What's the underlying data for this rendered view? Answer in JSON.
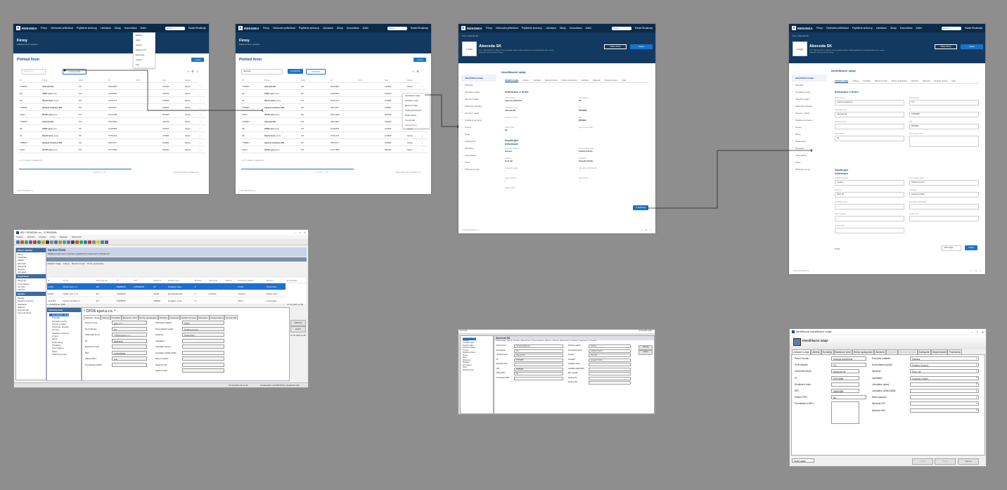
{
  "brand": "RENOMIA",
  "nav": [
    "Firmy",
    "Obchodní příležitost",
    "Pojištěné smlouvy",
    "Likvidace",
    "Úkoly",
    "Konzultace",
    "Další"
  ],
  "user": "Radek Rindánský",
  "search_placeholder": "Hledat",
  "screen1": {
    "title": "Firmy",
    "subtitle": "Evidence firem v systému",
    "section": "Přehled firem",
    "new_button": "+ Nový",
    "filter_placeholder": "Hledat IČO",
    "filter_button": "Upřesnit filtr",
    "columns": [
      "IČ",
      "Firma",
      "Druh",
      "IČ",
      "DIČ",
      "",
      "Kod",
      "Název"
    ],
    "rows": [
      [
        "7766897",
        "Abeceda SK",
        "PO",
        "25224903",
        "",
        "412250",
        "Název"
      ],
      [
        "ZE",
        "ZZSN spol s.r.o.",
        "PO",
        "12249653",
        "",
        "412250",
        "Název"
      ],
      [
        "SK",
        "Školní Auto, s.r.o.",
        "PO",
        "75751271",
        "",
        "274580",
        "Název"
      ],
      [
        "7766897",
        "Správní družstvo 263",
        "PO",
        "23572377",
        "",
        "234580",
        "Název"
      ],
      [
        "12321",
        "ČFOS spol.s.r.o.",
        "PO",
        "22717383",
        "",
        "506280",
        "Název"
      ],
      [
        "7766897",
        "Abeceda SK",
        "PO",
        "25224903",
        "",
        "412250",
        "Název"
      ],
      [
        "ZE",
        "ZZSN spol s.r.o.",
        "PO",
        "12249653",
        "",
        "412250",
        "Název"
      ],
      [
        "SK",
        "Školní Auto, s.r.o.",
        "PO",
        "75751271",
        "",
        "274580",
        "Název"
      ],
      [
        "7766897",
        "Správní družstvo 263",
        "PO",
        "23572377",
        "",
        "234580",
        "Název"
      ],
      [
        "12321",
        "ČFOS spol.s.r.o.",
        "PO",
        "22717383",
        "",
        "506280",
        "Název"
      ]
    ],
    "count": "1–17 z celkem 1 nalezených",
    "pager": "‹ 1 2 3 4 5 … 10 ›",
    "per_page": "Počet záznamů na stránku: 10",
    "dropdown": [
      "Zápisem",
      "Uložit",
      "Upravit",
      "Vyjmout a IČ",
      "Exportovat",
      "Vytvořit",
      "Tisk"
    ]
  },
  "screen2": {
    "filter_select": "Abeceda",
    "filter_button": "Použít filtr",
    "clear_button": "Zrušit filtr",
    "context_menu": [
      "Identifikační údaje",
      "Kontaktní osoby",
      "Bankovní údaje",
      "Předat obchodníkovi",
      "Přidat obchod",
      "Vytvořit úkol",
      "Odstranit firmu"
    ]
  },
  "screen3": {
    "crumb": "Firmy / Abeceda SK",
    "company": "Abeceda SK",
    "logo": "Logo",
    "description": "IČ 01 · Abeceda SK se sídlem v Praze, poskytuje služby v oblasti pojišťovnictví, podnikatelských rizik a správy pojistných smluv pro firemní klienty.",
    "hbtn1": "Přidat obchod",
    "hbtn2": "Upravit",
    "panel_title": "Identifikační údaje",
    "side": [
      "Identifikační údaje",
      "Pobočky",
      "Kontaktní osoby",
      "Finanční údaje",
      "Obchodní případy",
      "Termíny / úkoly",
      "Pojištěné smlouvy",
      "Kmeny",
      "Úkoly",
      "Dokumenty",
      "Předávky",
      "Komunikace",
      "Úkoly",
      "Přiřazené prvky"
    ],
    "tabs": [
      "Základní údaje",
      "Adresy",
      "Kontakty",
      "Bankovní účet",
      "Druhy spolupráce",
      "Akvizice",
      "Závazek",
      "Správní proces",
      "Kate"
    ],
    "info_title": "Informace o firmě",
    "fields": [
      {
        "l": "Právní forma",
        "v": "Akciová společnost"
      },
      {
        "l": "Druh klienta",
        "v": "PO"
      },
      {
        "l": "Obchodní firma",
        "v": "Abeceda SK"
      },
      {
        "l": "IČ",
        "v": "87876868"
      },
      {
        "l": "Evidenční číslo",
        "v": "–"
      },
      {
        "l": "DIČ",
        "v": "68T9999"
      },
      {
        "l": "Plátce DPH",
        "v": "Ne"
      },
      {
        "l": "Poznámka k DPH",
        "v": "–"
      }
    ],
    "extra_title": "Doplňující informace",
    "extra": [
      {
        "l": "Pobočka makléře",
        "v": "Ostrava"
      },
      {
        "l": "Komunikační jazyk",
        "v": "Čeština (Czech)"
      },
      {
        "l": "Správce",
        "v": "Čech Jiří"
      },
      {
        "l": "Likvidátor",
        "v": "Kopecký Ondřej"
      },
      {
        "l": "Likvidátor (auto)",
        "v": "–"
      },
      {
        "l": "Likvidátor (ZAM-ZAM)",
        "v": "–"
      },
      {
        "l": "Risk manažer",
        "v": "–"
      },
      {
        "l": "Správce PO",
        "v": "–"
      },
      {
        "l": "Správce MO",
        "v": "–"
      }
    ],
    "edit_button": "✎ Editovat",
    "footer": "© 2022 RENOMIA a.s."
  },
  "screen4": {
    "cancel": "Zrušit",
    "save": "Uložit",
    "save_dropdown": "Uložit údaje",
    "fields": [
      {
        "l": "Právní forma",
        "v": "Akciová společnost"
      },
      {
        "l": "Druh klienta",
        "v": "PO"
      },
      {
        "l": "Obchodní firma",
        "v": "Abeceda SK"
      },
      {
        "l": "IČ",
        "v": "87876868"
      },
      {
        "l": "Evidenční číslo",
        "v": ""
      },
      {
        "l": "DIČ",
        "v": "68T9999"
      },
      {
        "l": "Plátce DPH",
        "v": "Ne"
      },
      {
        "l": "Poznámka k DPH",
        "v": ""
      }
    ]
  },
  "desktop": {
    "title": "RELY RENOMIA, a.s. - ® RENOMIA",
    "menu": [
      "Soubor",
      "Zobrazit",
      "Moduly",
      "Firmy",
      "Nástroje",
      "Nápověda"
    ],
    "left_sections": [
      {
        "h": "Hlavní nabídka",
        "items": [
          "Firmy",
          "Pojistitelé",
          "Makléř",
          "Klientské",
          "Zákazník",
          "Reporty",
          "Uživatelé"
        ]
      },
      {
        "h": "Organizace",
        "items": [
          "Úkoly (0)",
          "Komunikace",
          "Termíny",
          "Vyřízení"
        ]
      },
      {
        "h": "Správa",
        "items": [
          "Moduly",
          "Pojistné smlouvy",
          "Kalkulace",
          "Šablony",
          "Číselník dat",
          "Typy záznamů"
        ]
      }
    ],
    "app_title": "Správa firem",
    "app_sub": "Základní informace o firmách, pojištěných smlouvách a likvidacích",
    "grid_header": [
      "ID",
      "Firma",
      "Druh klienta",
      "IČ",
      "DIČ",
      "NACE #",
      "NACE název",
      "Předaní",
      "Kategorie",
      "Záloha",
      "Pobočka makléře",
      "Správce",
      "Spravovatel"
    ],
    "grid_rows": [
      [
        "12321",
        "ČFOS spol.s.r.o.",
        "PO",
        "05289535",
        "C25090435",
        "26",
        "Prodejem auta",
        "K",
        "",
        "",
        "Praha",
        "Český Dani"
      ],
      [
        "12323",
        "CKMF spol. s.r.o.",
        "PO",
        "12345578",
        "",
        "45120",
        "Zprostředkování",
        "A",
        "KK DCA",
        "",
        "Ostrava",
        "Polední Jan"
      ],
      [
        "1211763",
        "Správní družstvo 2...",
        "PO",
        "05289535",
        "",
        "202560",
        "Prodejem a spr.",
        "K",
        "",
        "",
        "Plzeň",
        "Cesmoddni"
      ]
    ],
    "count": "1–17/2241 str. 4/36",
    "date": "07.02.2023 14:55",
    "detail_title": "* ČFOS spol.s.r.o. *",
    "tree_top": "Všechny firmy",
    "tree": [
      "Identifikační údaje",
      "Pobočky",
      "Kontaktní osoby",
      "Finanční údaje",
      "Obchodní případy",
      "Termíny",
      "Pojištěné smlouvy",
      "Kmeny",
      "Úkoly",
      "Dokumenty",
      "Předávky",
      "Komunikace",
      "Úkoly",
      "Přiřazené prvky"
    ],
    "tabs": [
      "Základní údaje",
      "Adresy",
      "Kontakty",
      "Bankovní účet",
      "Druhy spolupráce",
      "Akvizice",
      "Závazek",
      "Správní proces",
      "Kategorie",
      "Segmentace",
      "Poznámka"
    ],
    "left_fields": [
      {
        "l": "Právní forma:",
        "v": "spol. s.r.o."
      },
      {
        "l": "Druh klienta:",
        "v": "PO"
      },
      {
        "l": "Obchodní firma:",
        "v": "* ČFOS spol.s.r.o. *"
      },
      {
        "l": "IČ:",
        "v": "05289535"
      },
      {
        "l": "Evidenční číslo:",
        "v": ""
      },
      {
        "l": "DIČ:",
        "v": "CZ05289535"
      },
      {
        "l": "Plátce DPH:",
        "v": "Ano"
      },
      {
        "l": "Poznámka k DPH:",
        "v": ""
      }
    ],
    "right_fields": [
      {
        "l": "Pobočka makléře:",
        "v": "Praha"
      },
      {
        "l": "Komunikační jazyk:",
        "v": "Čeština (Czech)"
      },
      {
        "l": "Správce:",
        "v": "Český Dani"
      },
      {
        "l": "Likvidátor:",
        "v": ""
      },
      {
        "l": "Likvidátor (auto):",
        "v": ""
      },
      {
        "l": "Likvidátor (ZAM-ZAM):",
        "v": ""
      },
      {
        "l": "Risk manažer:",
        "v": ""
      },
      {
        "l": "Správce PO:",
        "v": ""
      },
      {
        "l": "Správce MO:",
        "v": ""
      }
    ],
    "btn_edit": "Editovat",
    "btn_close": "Zavřít",
    "status_date": "07.02.2023 14:11:44",
    "status_db": "sbuldersRD: (DATROSSO) (Sroker01.CZ)"
  },
  "mini": {
    "title": "Abeceda SK",
    "version": "9.0 b 3.41"
  },
  "dialog": {
    "title": "Modifikovat identifikační údaje",
    "heading": "Identifikační údaje",
    "tabs": [
      "Základní údaje",
      "Adresy",
      "Kontakty",
      "Bankovní účet",
      "Druhy spolupráce",
      "Akvizice",
      "Závazek",
      "Správní proces",
      "Kategorie",
      "Segmentace",
      "Poznámka"
    ],
    "left_fields": [
      {
        "l": "Právní forma:",
        "v": "Akciová společnost"
      },
      {
        "l": "Druh klienta:",
        "v": "PO"
      },
      {
        "l": "Obchodní firma:",
        "v": "Abeceda SK"
      },
      {
        "l": "IČ:",
        "v": "87876868"
      },
      {
        "l": "Evidenční číslo:",
        "v": ""
      },
      {
        "l": "DIČ:",
        "v": "68686888"
      },
      {
        "l": "Plátce DPH:",
        "v": "Ne"
      },
      {
        "l": "Poznámka k DPH:",
        "v": ""
      }
    ],
    "right_fields": [
      {
        "l": "Pobočka makléře:",
        "v": "Ostrava"
      },
      {
        "l": "Komunikační jazyk:",
        "v": "Čeština (Czech)"
      },
      {
        "l": "Správce:",
        "v": "Čech Jiří"
      },
      {
        "l": "Likvidátor:",
        "v": "Kopecký Ondřej"
      },
      {
        "l": "Likvidátor (auto):",
        "v": ""
      },
      {
        "l": "Likvidátor (ZAM-ZAM):",
        "v": ""
      },
      {
        "l": "Risk manažer:",
        "v": ""
      },
      {
        "l": "Správce PO:",
        "v": ""
      },
      {
        "l": "Správce MO:",
        "v": ""
      }
    ],
    "save_select": "Uložit údaje",
    "btn_back": "Použít",
    "btn_save": "Uložit",
    "btn_cancel": "Storno"
  }
}
